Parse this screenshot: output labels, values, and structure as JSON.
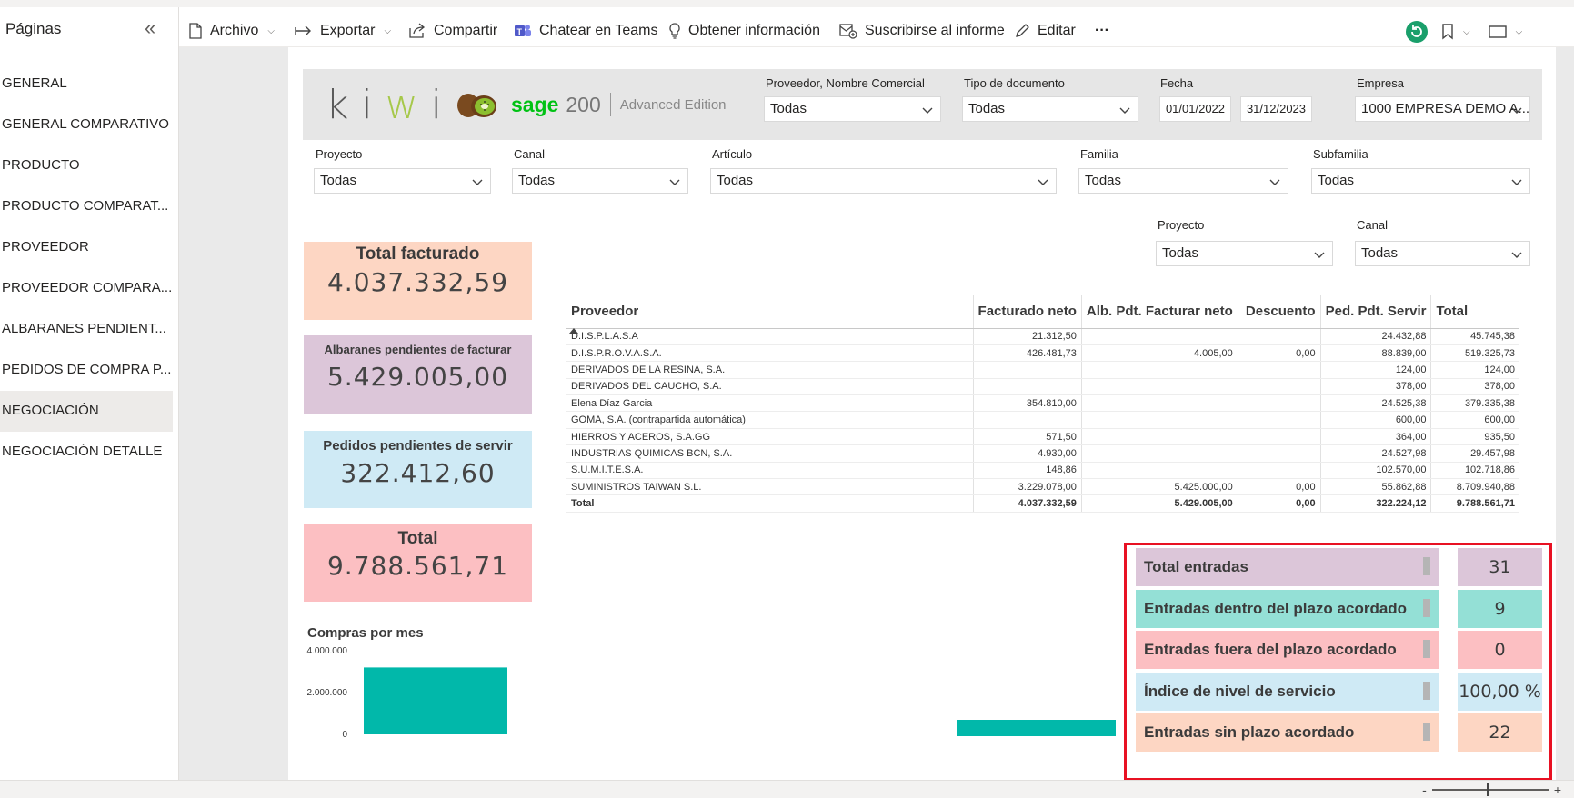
{
  "sidebar": {
    "title": "Páginas",
    "collapse_icon": "«",
    "items": [
      {
        "label": "GENERAL"
      },
      {
        "label": "GENERAL COMPARATIVO"
      },
      {
        "label": "PRODUCTO"
      },
      {
        "label": "PRODUCTO COMPARAT..."
      },
      {
        "label": "PROVEEDOR"
      },
      {
        "label": "PROVEEDOR COMPARA..."
      },
      {
        "label": "ALBARANES PENDIENT..."
      },
      {
        "label": "PEDIDOS DE COMPRA P..."
      },
      {
        "label": "NEGOCIACIÓN",
        "active": true
      },
      {
        "label": "NEGOCIACIÓN DETALLE"
      }
    ]
  },
  "toolbar": {
    "archivo": "Archivo",
    "exportar": "Exportar",
    "compartir": "Compartir",
    "teams": "Chatear en Teams",
    "info": "Obtener información",
    "suscribirse": "Suscribirse al informe",
    "editar": "Editar",
    "more": "···"
  },
  "logo": {
    "kiwi_k": "k",
    "kiwi_i1": "i",
    "kiwi_w": "w",
    "kiwi_i2": "i",
    "sage": "sage",
    "sage_num": "200",
    "edition": "Advanced Edition"
  },
  "filters": {
    "proveedor": {
      "label": "Proveedor, Nombre Comercial",
      "value": "Todas"
    },
    "tipo_doc": {
      "label": "Tipo de documento",
      "value": "Todas"
    },
    "fecha": {
      "label": "Fecha",
      "from": "01/01/2022",
      "to": "31/12/2023"
    },
    "empresa": {
      "label": "Empresa",
      "value": "1000 EMPRESA DEMO A..."
    },
    "proyecto": {
      "label": "Proyecto",
      "value": "Todas"
    },
    "canal": {
      "label": "Canal",
      "value": "Todas"
    },
    "articulo": {
      "label": "Artículo",
      "value": "Todas"
    },
    "familia": {
      "label": "Familia",
      "value": "Todas"
    },
    "subfamilia": {
      "label": "Subfamilia",
      "value": "Todas"
    },
    "proyecto2": {
      "label": "Proyecto",
      "value": "Todas"
    },
    "canal2": {
      "label": "Canal",
      "value": "Todas"
    }
  },
  "kpis": {
    "facturado": {
      "title": "Total facturado",
      "value": "4.037.332,59",
      "color": "#fdd6c3"
    },
    "albaranes": {
      "title": "Albaranes pendientes de facturar",
      "value": "5.429.005,00",
      "color": "#dcc6d9"
    },
    "pedidos": {
      "title": "Pedidos pendientes de servir",
      "value": "322.412,60",
      "color": "#cfeaf5"
    },
    "total": {
      "title": "Total",
      "value": "9.788.561,71",
      "color": "#fcbfc2"
    }
  },
  "table": {
    "headers": [
      "Proveedor",
      "Facturado neto",
      "Alb. Pdt. Facturar neto",
      "Descuento",
      "Ped. Pdt. Servir",
      "Total"
    ],
    "rows": [
      [
        "D.I.S.P.L.A.S.A",
        "21.312,50",
        "",
        "",
        "24.432,88",
        "45.745,38"
      ],
      [
        "D.I.S.P.R.O.V.A.S.A.",
        "426.481,73",
        "4.005,00",
        "0,00",
        "88.839,00",
        "519.325,73"
      ],
      [
        "DERIVADOS DE LA RESINA, S.A.",
        "",
        "",
        "",
        "124,00",
        "124,00"
      ],
      [
        "DERIVADOS DEL CAUCHO, S.A.",
        "",
        "",
        "",
        "378,00",
        "378,00"
      ],
      [
        "Elena Díaz Garcia",
        "354.810,00",
        "",
        "",
        "24.525,38",
        "379.335,38"
      ],
      [
        "GOMA, S.A. (contrapartida automática)",
        "",
        "",
        "",
        "600,00",
        "600,00"
      ],
      [
        "HIERROS Y ACEROS, S.A.GG",
        "571,50",
        "",
        "",
        "364,00",
        "935,50"
      ],
      [
        "INDUSTRIAS QUIMICAS BCN, S.A.",
        "4.930,00",
        "",
        "",
        "24.527,98",
        "29.457,98"
      ],
      [
        "S.U.M.I.T.E.S.A.",
        "148,86",
        "",
        "",
        "102.570,00",
        "102.718,86"
      ],
      [
        "SUMINISTROS TAIWAN S.L.",
        "3.229.078,00",
        "5.425.000,00",
        "0,00",
        "55.862,88",
        "8.709.940,88"
      ]
    ],
    "total": [
      "Total",
      "4.037.332,59",
      "5.429.005,00",
      "0,00",
      "322.224,12",
      "9.788.561,71"
    ]
  },
  "chart_data": {
    "type": "bar",
    "title": "Compras por mes",
    "categories": [
      ""
    ],
    "values": [
      3200000
    ],
    "ylim": [
      0,
      4000000
    ],
    "yticks": [
      "4.000.000",
      "2.000.000",
      "0"
    ],
    "bar_color": "#01b8aa"
  },
  "stats": [
    {
      "label": "Total entradas",
      "value": "31",
      "color": "#dcc6d9"
    },
    {
      "label": "Entradas dentro del plazo acordado",
      "value": "9",
      "color": "#94e0d6"
    },
    {
      "label": "Entradas fuera del plazo acordado",
      "value": "0",
      "color": "#fcbfc2"
    },
    {
      "label": "Índice de nivel de servicio",
      "value": "100,00 %",
      "color": "#cfeaf5"
    },
    {
      "label": "Entradas sin plazo acordado",
      "value": "22",
      "color": "#fdd6c3"
    }
  ],
  "zoom": {
    "minus": "-",
    "plus": "+"
  }
}
